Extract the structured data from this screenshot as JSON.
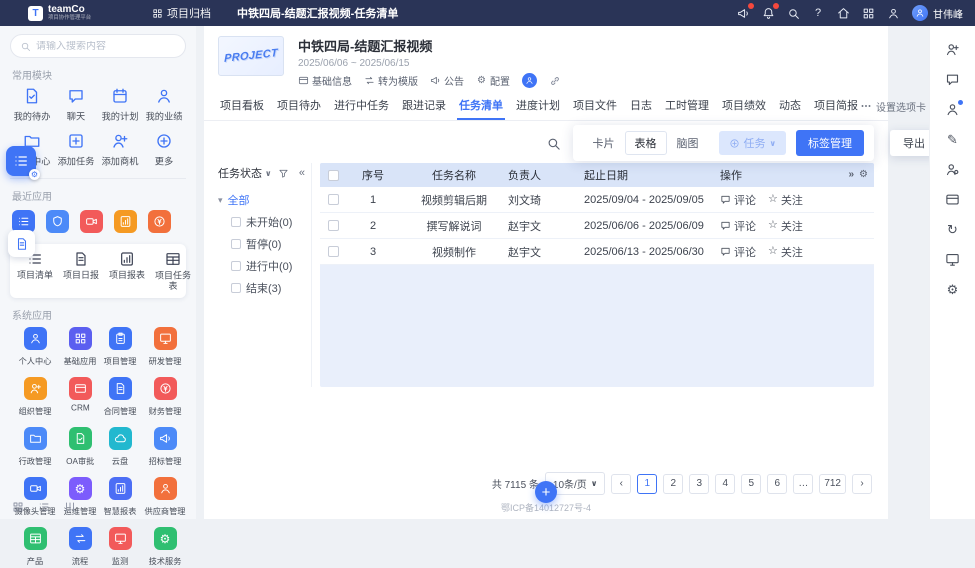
{
  "topbar": {
    "logo_text": "teamCo",
    "logo_tagline": "项目协作管理平台",
    "nav_archive": "项目归档",
    "breadcrumb": "中铁四局-结题汇报视频-任务清单",
    "icons": [
      {
        "name": "megaphone-icon",
        "icon": "megaphone",
        "badge": true
      },
      {
        "name": "bell-icon",
        "icon": "bell",
        "badge": true
      },
      {
        "name": "search-icon",
        "icon": "search"
      },
      {
        "name": "help-icon",
        "icon": "help"
      },
      {
        "name": "home-icon",
        "icon": "home"
      },
      {
        "name": "apps-icon",
        "icon": "grid"
      },
      {
        "name": "profile-icon",
        "icon": "person"
      }
    ],
    "user_name": "甘伟峰"
  },
  "sidebar": {
    "search_placeholder": "请输入搜索内容",
    "section_common": "常用模块",
    "quick_modules": [
      {
        "label": "我的待办",
        "icon": "doc-check",
        "name": "sidebar-item-my-todos"
      },
      {
        "label": "聊天",
        "icon": "chat",
        "name": "sidebar-item-chat"
      },
      {
        "label": "我的计划",
        "icon": "calendar",
        "name": "sidebar-item-my-plan"
      },
      {
        "label": "我的业绩",
        "icon": "person",
        "name": "sidebar-item-my-performance"
      },
      {
        "label": "文件中心",
        "icon": "folder",
        "name": "sidebar-item-file-center"
      },
      {
        "label": "添加任务",
        "icon": "plus-square",
        "name": "sidebar-item-add-task"
      },
      {
        "label": "添加商机",
        "icon": "person-plus",
        "name": "sidebar-item-add-opportunity"
      },
      {
        "label": "更多",
        "icon": "plus-circle",
        "name": "sidebar-item-more"
      }
    ],
    "section_recent": "最近应用",
    "recent_apps": [
      {
        "icon": "list",
        "color": "#3f74f6",
        "name": "recent-app-1"
      },
      {
        "icon": "shield",
        "color": "#4c8af8",
        "name": "recent-app-2"
      },
      {
        "icon": "camera",
        "color": "#f25a5a",
        "name": "recent-app-3"
      },
      {
        "icon": "report",
        "color": "#f59a23",
        "name": "recent-app-4"
      },
      {
        "icon": "money",
        "color": "#f2703c",
        "name": "recent-app-5"
      }
    ],
    "pinned_views": [
      {
        "label": "项目清单",
        "icon": "list",
        "name": "pinned-project-list"
      },
      {
        "label": "项目日报",
        "icon": "doc",
        "name": "pinned-project-daily"
      },
      {
        "label": "项目报表",
        "icon": "report",
        "name": "pinned-project-report"
      },
      {
        "label": "项目任务表",
        "icon": "table",
        "name": "pinned-project-task-table"
      }
    ],
    "section_system": "系统应用",
    "system_apps": [
      {
        "label": "个人中心",
        "icon": "person",
        "color": "#3f74f6"
      },
      {
        "label": "基础应用",
        "icon": "grid",
        "color": "#5b5ff0"
      },
      {
        "label": "项目管理",
        "icon": "clipboard",
        "color": "#3f74f6"
      },
      {
        "label": "研发管理",
        "icon": "monitor",
        "color": "#f2703c"
      },
      {
        "label": "组织管理",
        "icon": "person-plus",
        "color": "#f59a23"
      },
      {
        "label": "CRM",
        "icon": "card",
        "color": "#f25a5a"
      },
      {
        "label": "合同管理",
        "icon": "doc",
        "color": "#3f74f6"
      },
      {
        "label": "财务管理",
        "icon": "money",
        "color": "#f25a5a"
      },
      {
        "label": "行政管理",
        "icon": "folder",
        "color": "#4c8af8"
      },
      {
        "label": "OA审批",
        "icon": "doc-check",
        "color": "#2fbf71"
      },
      {
        "label": "云盘",
        "icon": "cloud",
        "color": "#22b8cf"
      },
      {
        "label": "招标管理",
        "icon": "megaphone",
        "color": "#4c8af8"
      },
      {
        "label": "摄像头管理",
        "icon": "camera",
        "color": "#3f74f6"
      },
      {
        "label": "运维管理",
        "icon": "gear",
        "color": "#7c5cfc"
      },
      {
        "label": "智慧报表",
        "icon": "report",
        "color": "#4c6ef5"
      },
      {
        "label": "供应商管理",
        "icon": "person",
        "color": "#f2703c"
      },
      {
        "label": "产品",
        "icon": "table",
        "color": "#2fbf71"
      },
      {
        "label": "流程",
        "icon": "swap",
        "color": "#3f74f6"
      },
      {
        "label": "监测",
        "icon": "monitor",
        "color": "#f25a5a"
      },
      {
        "label": "技术服务",
        "icon": "gear",
        "color": "#2fbf71"
      }
    ],
    "bottom_icons": [
      {
        "icon": "grid",
        "name": "apps-switch-icon"
      },
      {
        "icon": "list",
        "name": "list-view-icon"
      },
      {
        "icon": "columns",
        "name": "columns-view-icon"
      }
    ]
  },
  "floating": {
    "buttons": [
      {
        "icon": "list",
        "name": "quick-launcher-button"
      },
      {
        "icon": "doc",
        "name": "quick-form-button"
      }
    ]
  },
  "main": {
    "project": {
      "image_label": "PROJECT",
      "title": "中铁四局-结题汇报视频",
      "date_range": "2025/06/06 ~ 2025/06/15",
      "actions": [
        {
          "label": "基础信息",
          "icon": "card",
          "name": "basic-info-button"
        },
        {
          "label": "转为模版",
          "icon": "swap",
          "name": "convert-template-button"
        },
        {
          "label": "公告",
          "icon": "megaphone",
          "name": "announcement-button"
        },
        {
          "label": "配置",
          "icon": "gear",
          "name": "config-button"
        }
      ]
    },
    "tabs": [
      {
        "label": "项目看板"
      },
      {
        "label": "项目待办"
      },
      {
        "label": "进行中任务"
      },
      {
        "label": "跟进记录"
      },
      {
        "label": "任务清单",
        "active": true
      },
      {
        "label": "进度计划"
      },
      {
        "label": "项目文件"
      },
      {
        "label": "日志"
      },
      {
        "label": "工时管理"
      },
      {
        "label": "项目绩效"
      },
      {
        "label": "动态"
      },
      {
        "label": "项目简报"
      }
    ],
    "tab_settings": "设置选项卡",
    "toolbar": {
      "views": [
        {
          "label": "卡片"
        },
        {
          "label": "表格",
          "active": true
        },
        {
          "label": "脑图"
        }
      ],
      "task_button": "任务",
      "tag_button": "标签管理",
      "export_button": "导出"
    },
    "filter": {
      "title": "任务状态",
      "statuses": [
        {
          "label": "全部",
          "root": true,
          "active": true
        },
        {
          "label": "未开始(0)",
          "child": true
        },
        {
          "label": "暂停(0)",
          "child": true
        },
        {
          "label": "进行中(0)",
          "child": true
        },
        {
          "label": "结束(3)",
          "child": true
        }
      ]
    },
    "table": {
      "headers": [
        "序号",
        "任务名称",
        "负责人",
        "起止日期",
        "操作"
      ],
      "op_comment": "评论",
      "op_follow": "关注",
      "rows": [
        {
          "no": "1",
          "name": "视频剪辑后期",
          "owner": "刘文琦",
          "dates": "2025/09/04 - 2025/09/05"
        },
        {
          "no": "2",
          "name": "撰写解说词",
          "owner": "赵宇文",
          "dates": "2025/06/06 - 2025/06/09"
        },
        {
          "no": "3",
          "name": "视频制作",
          "owner": "赵宇文",
          "dates": "2025/06/13 - 2025/06/30"
        }
      ]
    },
    "pagination": {
      "total": "共 7115 条",
      "page_size": "10条/页",
      "pages": [
        {
          "label": "1",
          "active": true
        },
        {
          "label": "2"
        },
        {
          "label": "3"
        },
        {
          "label": "4"
        },
        {
          "label": "5"
        },
        {
          "label": "6"
        },
        {
          "label": "…"
        },
        {
          "label": "712"
        }
      ]
    },
    "fab_label": "+",
    "footer": "鄂ICP备14012727号-4"
  },
  "rail": {
    "icons": [
      {
        "icon": "person-plus",
        "name": "invite-member-icon"
      },
      {
        "icon": "chat",
        "name": "feedback-icon"
      },
      {
        "icon": "person",
        "name": "member-icon",
        "dot": true
      },
      {
        "icon": "pen",
        "name": "edit-icon"
      },
      {
        "icon": "person-gear",
        "name": "account-settings-icon"
      },
      {
        "icon": "card",
        "name": "contacts-icon"
      },
      {
        "icon": "refresh",
        "name": "sync-icon"
      },
      {
        "icon": "monitor",
        "name": "screen-share-icon"
      },
      {
        "icon": "gear",
        "name": "settings-icon"
      }
    ]
  }
}
